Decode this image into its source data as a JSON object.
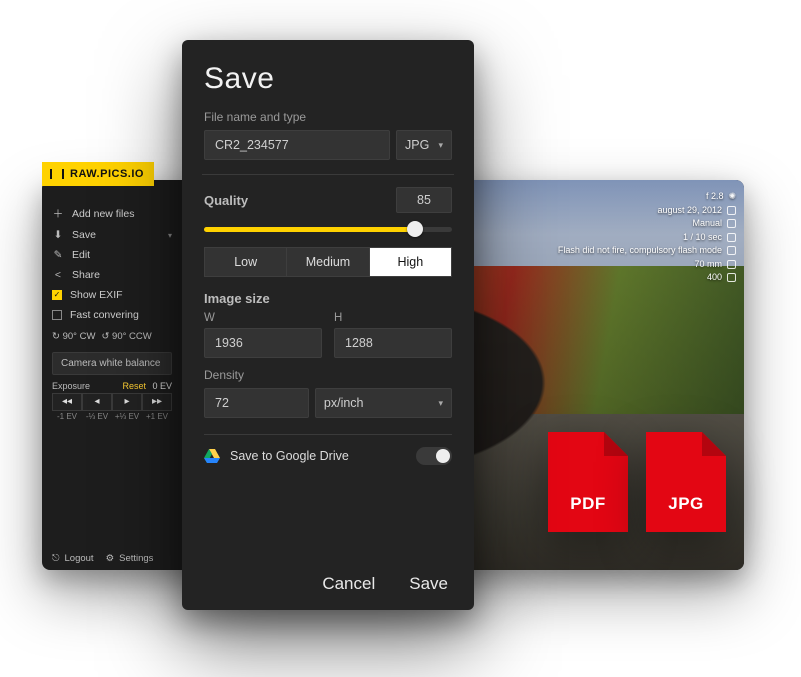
{
  "brand": "RAW.PICS.IO",
  "sidebar": {
    "items": [
      {
        "icon": "plus-icon",
        "label": "Add new files"
      },
      {
        "icon": "download-icon",
        "label": "Save",
        "has_submenu": true
      },
      {
        "icon": "pencil-icon",
        "label": "Edit"
      },
      {
        "icon": "share-icon",
        "label": "Share"
      },
      {
        "icon": "checkbox-on",
        "label": "Show EXIF",
        "checked": true
      },
      {
        "icon": "checkbox-off",
        "label": "Fast convering"
      }
    ],
    "rotate_cw": "↻ 90° CW",
    "rotate_ccw": "↺ 90° CCW",
    "wb_pill": "Camera white balance",
    "exposure_label": "Exposure",
    "exposure_reset": "Reset",
    "exposure_value": "0 EV",
    "ev_buttons": [
      "◂◂",
      "◂",
      "▸",
      "▸▸"
    ],
    "ev_labels": [
      "-1 EV",
      "-⅓ EV",
      "+⅓ EV",
      "+1 EV"
    ],
    "logout": "Logout",
    "settings": "Settings"
  },
  "exif": {
    "aperture": "f 2.8",
    "date": "august 29, 2012",
    "mode": "Manual",
    "shutter": "1 / 10 sec",
    "flash": "Flash did not fire, compulsory flash mode",
    "focal": "70 mm",
    "iso": "400"
  },
  "badges": {
    "pdf": "PDF",
    "jpg": "JPG"
  },
  "dialog": {
    "title": "Save",
    "filename_label": "File name and type",
    "filename": "CR2_234577",
    "format": "JPG",
    "quality_label": "Quality",
    "quality_value": "85",
    "quality_percent": 85,
    "quality_presets": {
      "low": "Low",
      "medium": "Medium",
      "high": "High",
      "selected": "high"
    },
    "imagesize_label": "Image size",
    "w_label": "W",
    "h_label": "H",
    "w": "1936",
    "h": "1288",
    "density_label": "Density",
    "density": "72",
    "density_unit": "px/inch",
    "gdrive_label": "Save to Google Drive",
    "cancel": "Cancel",
    "save": "Save"
  }
}
